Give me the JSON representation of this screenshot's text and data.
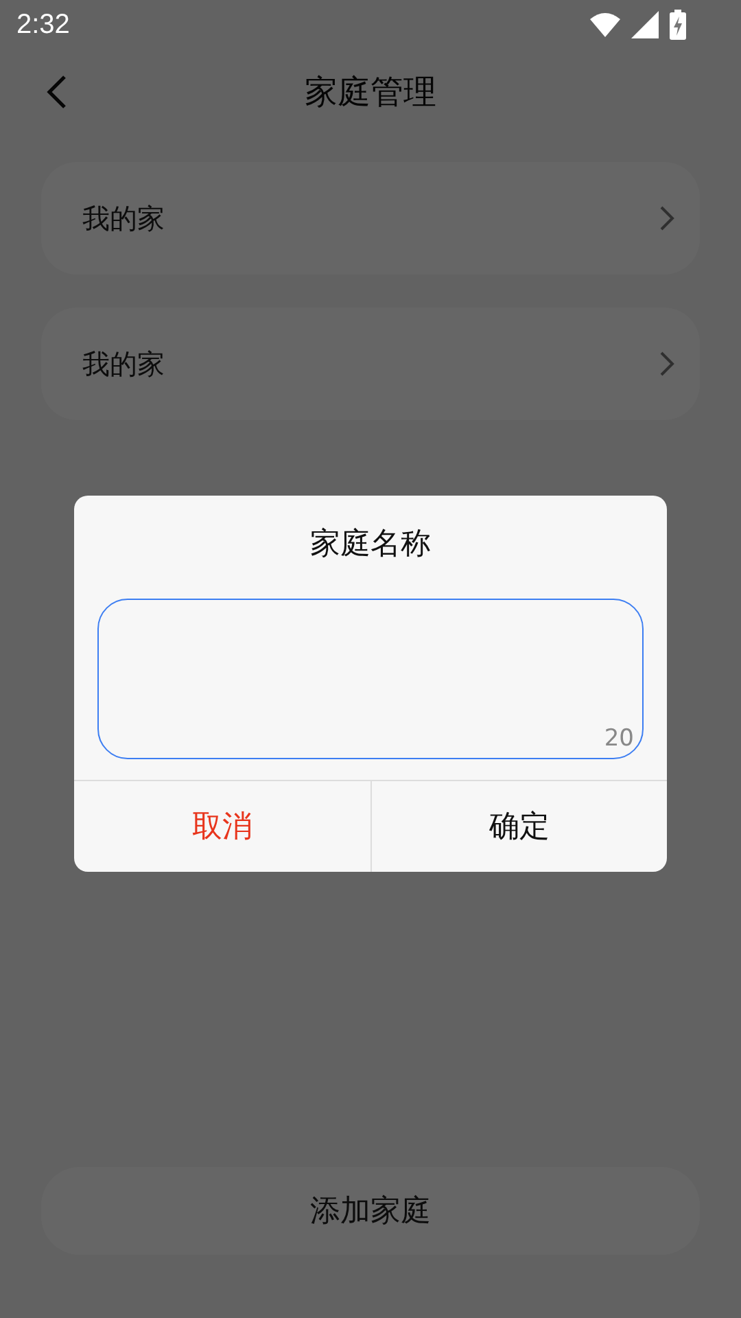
{
  "status_bar": {
    "time": "2:32"
  },
  "header": {
    "title": "家庭管理"
  },
  "homes": [
    {
      "name": "我的家"
    },
    {
      "name": "我的家"
    }
  ],
  "dialog": {
    "title": "家庭名称",
    "input": {
      "counter": "20",
      "focused": true
    },
    "buttons": [
      {
        "label": "取消",
        "kind": "cancel"
      },
      {
        "label": "确定",
        "kind": "confirm"
      }
    ]
  },
  "add_button": {
    "label": "添加家庭"
  }
}
